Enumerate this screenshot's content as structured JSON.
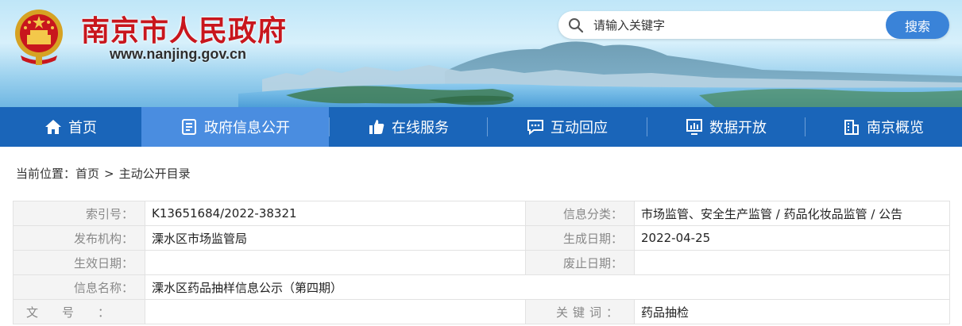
{
  "header": {
    "site_title": "南京市人民政府",
    "site_url": "www.nanjing.gov.cn",
    "search_placeholder": "请输入关键字",
    "search_button": "搜索",
    "brand_red": "#c8161d",
    "search_blue": "#3a83d8"
  },
  "nav": {
    "bg_color": "#1a65b9",
    "active_color": "#4a8de0",
    "items": [
      {
        "label": "首页",
        "icon": "home-icon"
      },
      {
        "label": "政府信息公开",
        "icon": "document-icon",
        "active": true
      },
      {
        "label": "在线服务",
        "icon": "thumbs-up-icon"
      },
      {
        "label": "互动回应",
        "icon": "chat-icon"
      },
      {
        "label": "数据开放",
        "icon": "chart-icon"
      },
      {
        "label": "南京概览",
        "icon": "building-icon"
      }
    ]
  },
  "breadcrumb": {
    "prefix": "当前位置：",
    "items": [
      "首页",
      "主动公开目录"
    ],
    "separator": ">"
  },
  "info": {
    "index_label": "索引号：",
    "index_value": "K13651684/2022-38321",
    "category_label": "信息分类：",
    "category_value": "市场监管、安全生产监管 / 药品化妆品监管 / 公告",
    "publisher_label": "发布机构：",
    "publisher_value": "溧水区市场监管局",
    "created_label": "生成日期：",
    "created_value": "2022-04-25",
    "effective_label": "生效日期：",
    "effective_value": "",
    "abolish_label": "废止日期：",
    "abolish_value": "",
    "name_label": "信息名称：",
    "name_value": "溧水区药品抽样信息公示（第四期）",
    "docno_label": "文号：",
    "docno_value": "",
    "keywords_label": "关键词：",
    "keywords_value": "药品抽检"
  }
}
